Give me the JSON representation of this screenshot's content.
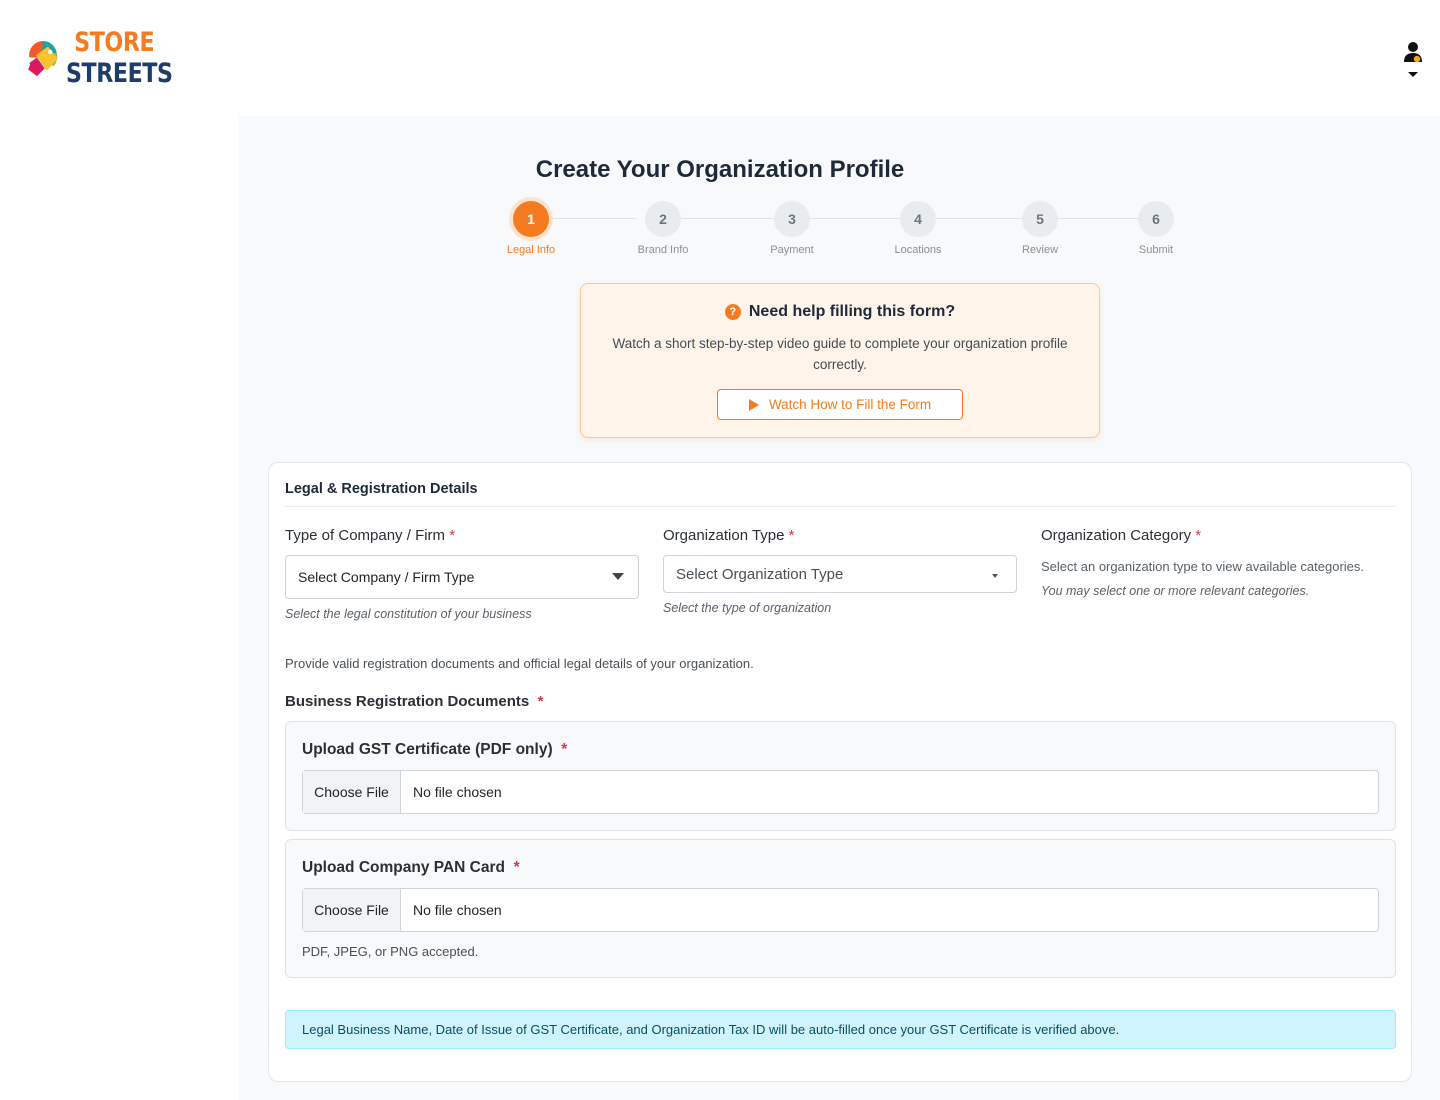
{
  "brand": {
    "line1": "STORE",
    "line2": "STREETS"
  },
  "page": {
    "title": "Create Your Organization Profile"
  },
  "stepper": {
    "steps": [
      {
        "number": "1",
        "label": "Legal Info",
        "active": true
      },
      {
        "number": "2",
        "label": "Brand Info",
        "active": false
      },
      {
        "number": "3",
        "label": "Payment",
        "active": false
      },
      {
        "number": "4",
        "label": "Locations",
        "active": false
      },
      {
        "number": "5",
        "label": "Review",
        "active": false
      },
      {
        "number": "6",
        "label": "Submit",
        "active": false
      }
    ]
  },
  "help": {
    "title": "Need help filling this form?",
    "text": "Watch a short step-by-step video guide to complete your organization profile correctly.",
    "button": "Watch How to Fill the Form"
  },
  "form": {
    "section_title": "Legal & Registration Details",
    "company_type": {
      "label": "Type of Company / Firm",
      "required_mark": "*",
      "value": "Select Company / Firm Type",
      "hint": "Select the legal constitution of your business"
    },
    "org_type": {
      "label": "Organization Type",
      "required_mark": "*",
      "value": "Select Organization Type",
      "hint": "Select the type of organization"
    },
    "org_category": {
      "label": "Organization Category",
      "required_mark": "*",
      "text": "Select an organization type to view available categories.",
      "hint": "You may select one or more relevant categories."
    },
    "docs_intro": "Provide valid registration documents and official legal details of your organization.",
    "docs_heading": "Business Registration Documents",
    "docs_required_mark": "*",
    "gst": {
      "label": "Upload GST Certificate (PDF only)",
      "required_mark": "*",
      "button": "Choose File",
      "status": "No file chosen"
    },
    "pan": {
      "label": "Upload Company PAN Card",
      "required_mark": "*",
      "button": "Choose File",
      "status": "No file chosen",
      "note": "PDF, JPEG, or PNG accepted."
    },
    "info": "Legal Business Name, Date of Issue of GST Certificate, and Organization Tax ID will be auto-filled once your GST Certificate is verified above."
  },
  "colors": {
    "accent": "#f47b20",
    "brand_dark": "#1f3d6b",
    "info_bg": "#cff4fc"
  },
  "icons": {
    "help": "question-circle-icon",
    "play": "play-icon",
    "user": "user-icon",
    "dropdown": "caret-down-icon"
  }
}
